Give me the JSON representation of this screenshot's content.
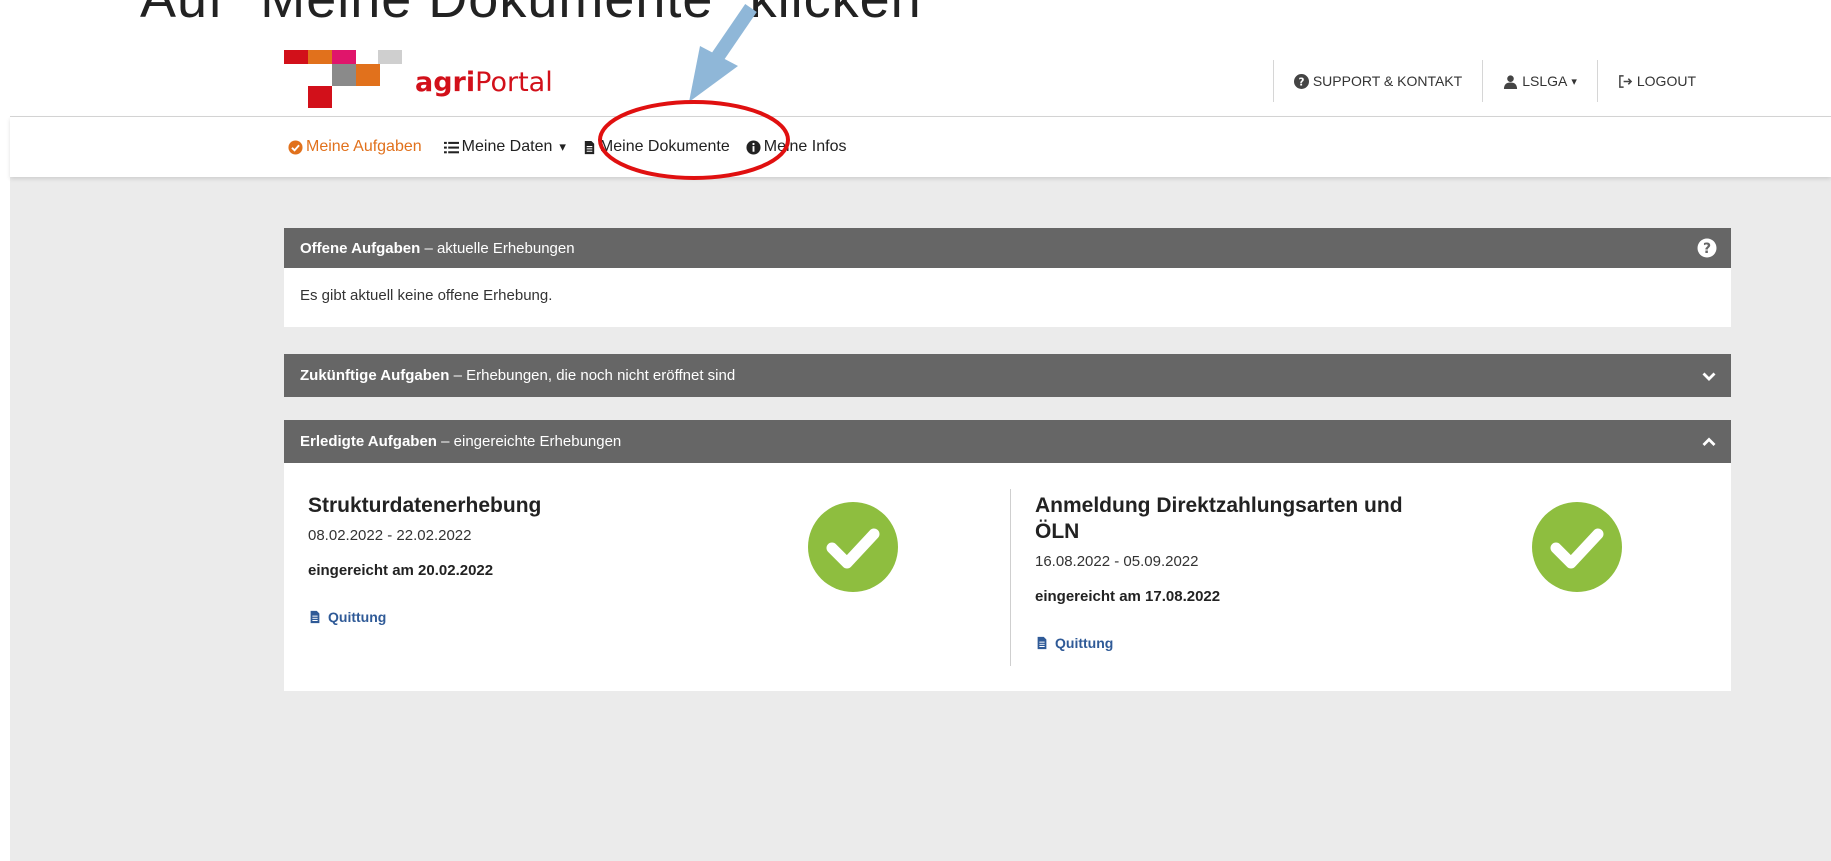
{
  "slide": {
    "title": "Auf \"Meine Dokumente\" klicken"
  },
  "header": {
    "logo_bold": "agri",
    "logo_rest": "Portal",
    "nav": [
      {
        "label": "SUPPORT & KONTAKT",
        "icon": "question-circle-icon"
      },
      {
        "label": "LSLGA",
        "icon": "user-icon",
        "caret": "▾"
      },
      {
        "label": "LOGOUT",
        "icon": "logout-icon"
      }
    ]
  },
  "main_nav": [
    {
      "label": "Meine Aufgaben",
      "icon": "check-circle-icon",
      "active": true
    },
    {
      "label": "Meine Daten",
      "icon": "list-icon",
      "caret": "▾"
    },
    {
      "label": "Meine Dokumente",
      "icon": "document-icon"
    },
    {
      "label": "Meine Infos",
      "icon": "info-circle-icon"
    }
  ],
  "panels": {
    "open": {
      "title": "Offene Aufgaben",
      "subtitle": " – aktuelle Erhebungen",
      "message": "Es gibt aktuell keine offene Erhebung."
    },
    "future": {
      "title": "Zukünftige Aufgaben",
      "subtitle": " – Erhebungen, die noch nicht eröffnet sind"
    },
    "done": {
      "title": "Erledigte Aufgaben",
      "subtitle": " – eingereichte Erhebungen",
      "tasks": [
        {
          "title": "Strukturdatenerhebung",
          "dates": "08.02.2022 - 22.02.2022",
          "submitted": "eingereicht am 20.02.2022",
          "link": "Quittung"
        },
        {
          "title": "Anmeldung Direktzahlungsarten und ÖLN",
          "dates": "16.08.2022 - 05.09.2022",
          "submitted": "eingereicht am 17.08.2022",
          "link": "Quittung"
        }
      ]
    }
  },
  "colors": {
    "brand_red": "#d2101a",
    "brand_orange": "#e1711c",
    "header_gray": "#666666",
    "check_green": "#8ebe3f",
    "link_blue": "#2f5a97",
    "annotation_red": "#e01010",
    "annotation_arrow": "#8fb7d8"
  }
}
